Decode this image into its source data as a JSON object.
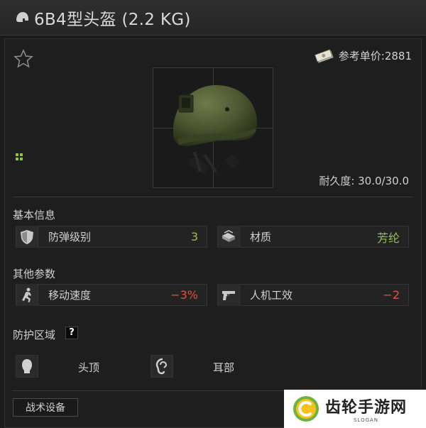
{
  "title": "6B4型头盔 (2.2 KG)",
  "price": {
    "label": "参考单价:",
    "value": "2881"
  },
  "durability": "耐久度: 30.0/30.0",
  "sections": {
    "basic": "基本信息",
    "other": "其他参数",
    "protection": "防护区域"
  },
  "stats": {
    "armor_class": {
      "label": "防弹级别",
      "value": "3",
      "color": "#9bbf4e"
    },
    "material": {
      "label": "材质",
      "value": "芳纶",
      "color": "#9bbf4e"
    },
    "move_speed": {
      "label": "移动速度",
      "value": "−3%",
      "color": "#d9543f"
    },
    "ergonomics": {
      "label": "人机工效",
      "value": "−2",
      "color": "#d9543f"
    }
  },
  "zones": [
    {
      "label": "头顶",
      "icon": "head-icon"
    },
    {
      "label": "耳部",
      "icon": "ear-icon"
    }
  ],
  "help_mark": "?",
  "tab_label": "战术设备",
  "watermark": {
    "main": "齿轮手游网",
    "sub": "SLOGAN"
  },
  "accent_colors": {
    "positive": "#9bbf4e",
    "negative": "#d9543f",
    "grid_icon": "#8dc63f"
  }
}
